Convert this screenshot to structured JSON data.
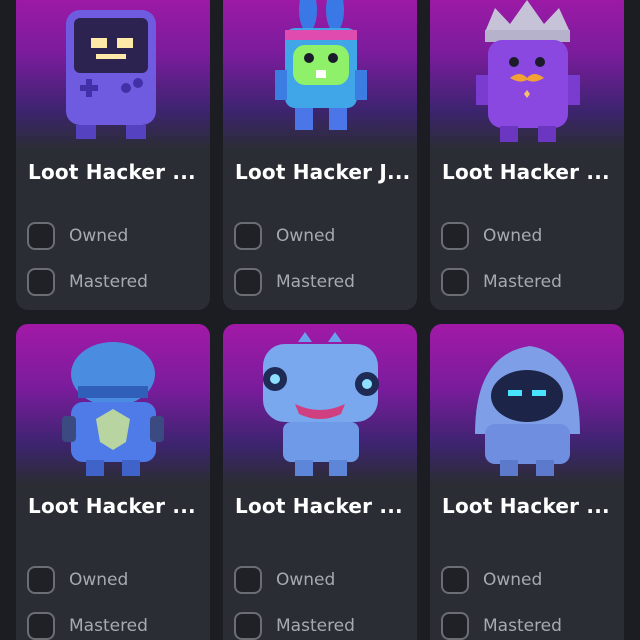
{
  "colors": {
    "page_bg": "#1b1d22",
    "card_bg": "#2a2d33",
    "art_top": "#a21aa7",
    "checkbox_border": "#6a6d74",
    "label_text": "#a7aab1"
  },
  "cards": [
    {
      "name": "Loot Hacker ...",
      "owned_label": "Owned",
      "mastered_label": "Mastered",
      "owned": false,
      "mastered": false,
      "character": "handheld-console-character"
    },
    {
      "name": "Loot Hacker J...",
      "owned_label": "Owned",
      "mastered_label": "Mastered",
      "owned": false,
      "mastered": false,
      "character": "bunny-character"
    },
    {
      "name": "Loot Hacker ...",
      "owned_label": "Owned",
      "mastered_label": "Mastered",
      "owned": false,
      "mastered": false,
      "character": "crowned-character"
    },
    {
      "name": "Loot Hacker ...",
      "owned_label": "Owned",
      "mastered_label": "Mastered",
      "owned": false,
      "mastered": false,
      "character": "armored-helmet-character"
    },
    {
      "name": "Loot Hacker ...",
      "owned_label": "Owned",
      "mastered_label": "Mastered",
      "owned": false,
      "mastered": false,
      "character": "dino-character"
    },
    {
      "name": "Loot Hacker ...",
      "owned_label": "Owned",
      "mastered_label": "Mastered",
      "owned": false,
      "mastered": false,
      "character": "hooded-character"
    }
  ]
}
